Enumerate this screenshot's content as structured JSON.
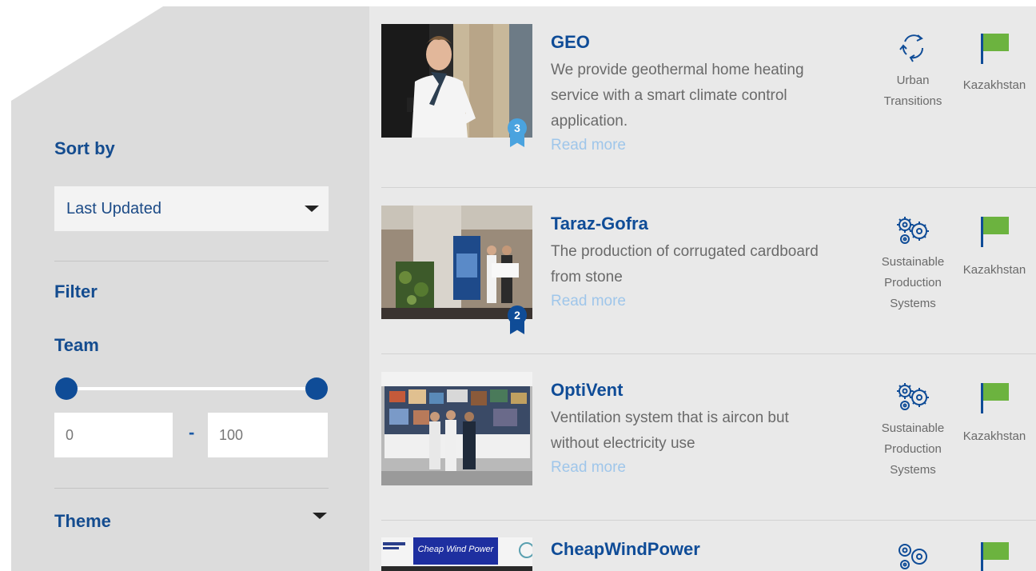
{
  "sidebar": {
    "sort_label": "Sort by",
    "sort_value": "Last Updated",
    "filter_label": "Filter",
    "team_label": "Team",
    "team_min": "0",
    "team_max": "100",
    "range_separator": "-",
    "theme_label": "Theme"
  },
  "projects": [
    {
      "title": "GEO",
      "description": "We provide geothermal home heating service with a smart climate control application.",
      "read_more": "Read more",
      "theme": "Urban Transitions",
      "theme_icon": "recycle-arrows-icon",
      "country": "Kazakhstan",
      "rank": "3"
    },
    {
      "title": "Taraz-Gofra",
      "description": "The production of corrugated cardboard from stone",
      "read_more": "Read more",
      "theme": "Sustainable Production Systems",
      "theme_icon": "gears-icon",
      "country": "Kazakhstan",
      "rank": "2"
    },
    {
      "title": "OptiVent",
      "description": "Ventilation system that is aircon but without electricity use",
      "read_more": "Read more",
      "theme": "Sustainable Production Systems",
      "theme_icon": "gears-icon",
      "country": "Kazakhstan"
    },
    {
      "title": "CheapWindPower",
      "banner_text": "Cheap Wind Power"
    }
  ],
  "colors": {
    "accent": "#0f4c97",
    "link": "#9fc6ea",
    "flag": "#6cb33f",
    "ribbon_light": "#4aa3df"
  }
}
